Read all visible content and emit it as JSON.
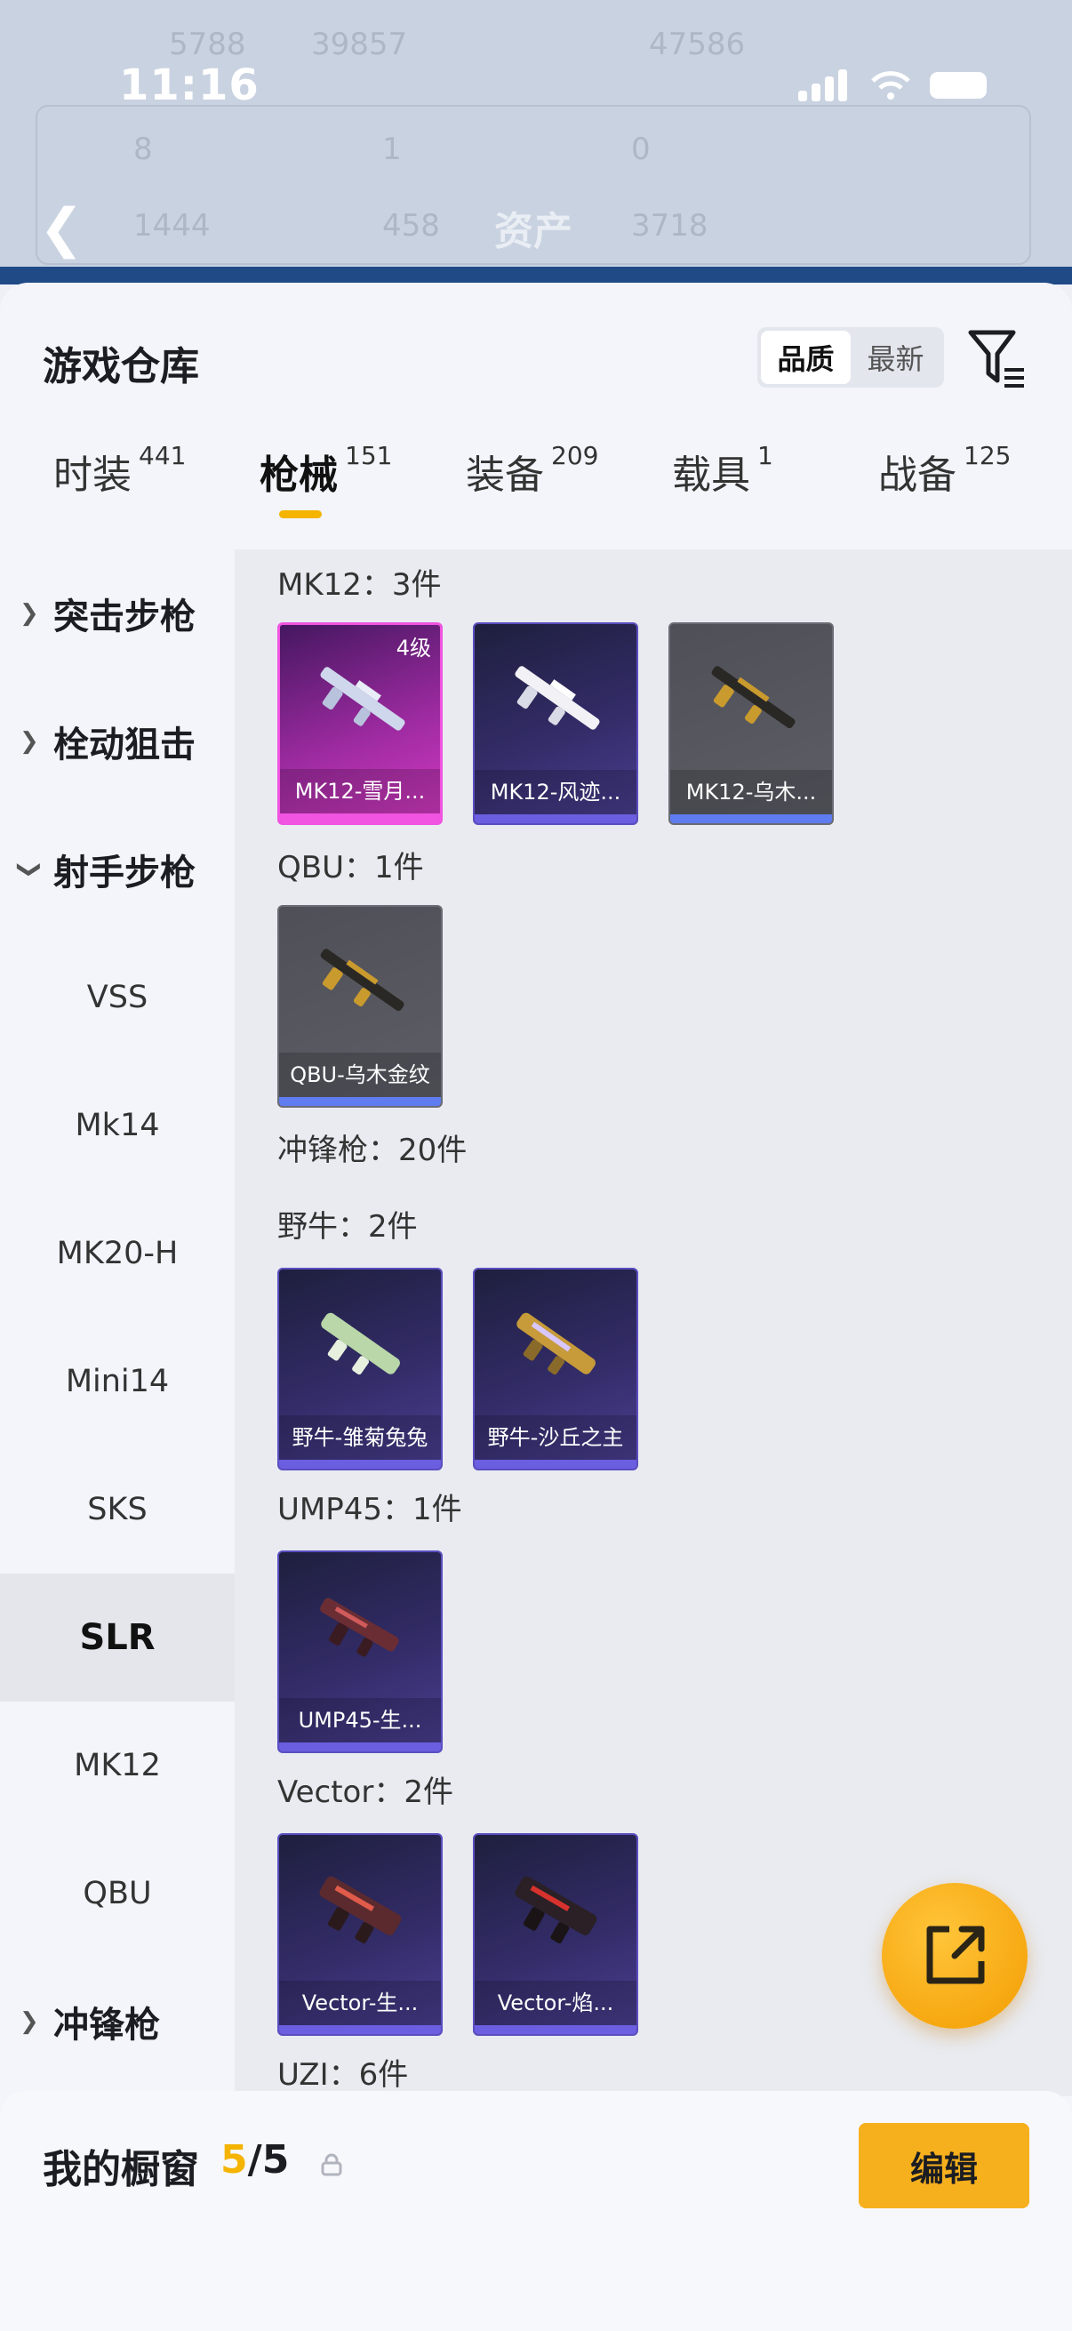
{
  "status_bar": {
    "time": "11:16"
  },
  "background": {
    "texts": [
      "5788",
      "39857",
      "47586",
      "8",
      "1",
      "0",
      "1444",
      "458",
      "3718"
    ],
    "title": "资产"
  },
  "warehouse": {
    "title": "游戏仓库",
    "sort_options": [
      "品质",
      "最新"
    ],
    "selected_sort": "品质"
  },
  "tabs": [
    {
      "label": "时装",
      "count": "441"
    },
    {
      "label": "枪械",
      "count": "151"
    },
    {
      "label": "装备",
      "count": "209"
    },
    {
      "label": "载具",
      "count": "1"
    },
    {
      "label": "战备",
      "count": "125"
    }
  ],
  "active_tab": "枪械",
  "sidebar": [
    {
      "label": "突击步枪",
      "type": "category",
      "expanded": false
    },
    {
      "label": "栓动狙击",
      "type": "category",
      "expanded": false
    },
    {
      "label": "射手步枪",
      "type": "category",
      "expanded": true
    },
    {
      "label": "VSS",
      "type": "item"
    },
    {
      "label": "Mk14",
      "type": "item"
    },
    {
      "label": "MK20-H",
      "type": "item"
    },
    {
      "label": "Mini14",
      "type": "item"
    },
    {
      "label": "SKS",
      "type": "item"
    },
    {
      "label": "SLR",
      "type": "item",
      "active": true
    },
    {
      "label": "MK12",
      "type": "item"
    },
    {
      "label": "QBU",
      "type": "item"
    },
    {
      "label": "冲锋枪",
      "type": "category",
      "expanded": false
    }
  ],
  "groups": [
    {
      "title": "MK12：3件",
      "items": [
        {
          "name": "MK12-雪月...",
          "rarity": "pink",
          "level": "4级"
        },
        {
          "name": "MK12-风迹...",
          "rarity": "purple"
        },
        {
          "name": "MK12-乌木...",
          "rarity": "grey"
        }
      ]
    },
    {
      "title": "QBU：1件",
      "items": [
        {
          "name": "QBU-乌木金纹",
          "rarity": "grey"
        }
      ]
    },
    {
      "title": "冲锋枪：20件",
      "items": []
    },
    {
      "title": "野牛：2件",
      "items": [
        {
          "name": "野牛-雏菊兔兔",
          "rarity": "purple"
        },
        {
          "name": "野牛-沙丘之主",
          "rarity": "purple"
        }
      ]
    },
    {
      "title": "UMP45：1件",
      "items": [
        {
          "name": "UMP45-生...",
          "rarity": "purple"
        }
      ]
    },
    {
      "title": "Vector：2件",
      "items": [
        {
          "name": "Vector-生...",
          "rarity": "purple"
        },
        {
          "name": "Vector-焰...",
          "rarity": "purple"
        }
      ]
    },
    {
      "title": "UZI：6件",
      "items": []
    }
  ],
  "showcase": {
    "label": "我的橱窗",
    "count_current": "5",
    "count_total": "/5",
    "edit_label": "编辑"
  },
  "colors": {
    "accent": "#f4b400",
    "purple_rarity": "#5a4ec0",
    "pink_rarity": "#f054e0",
    "grey_rarity": "#6b6c75"
  }
}
